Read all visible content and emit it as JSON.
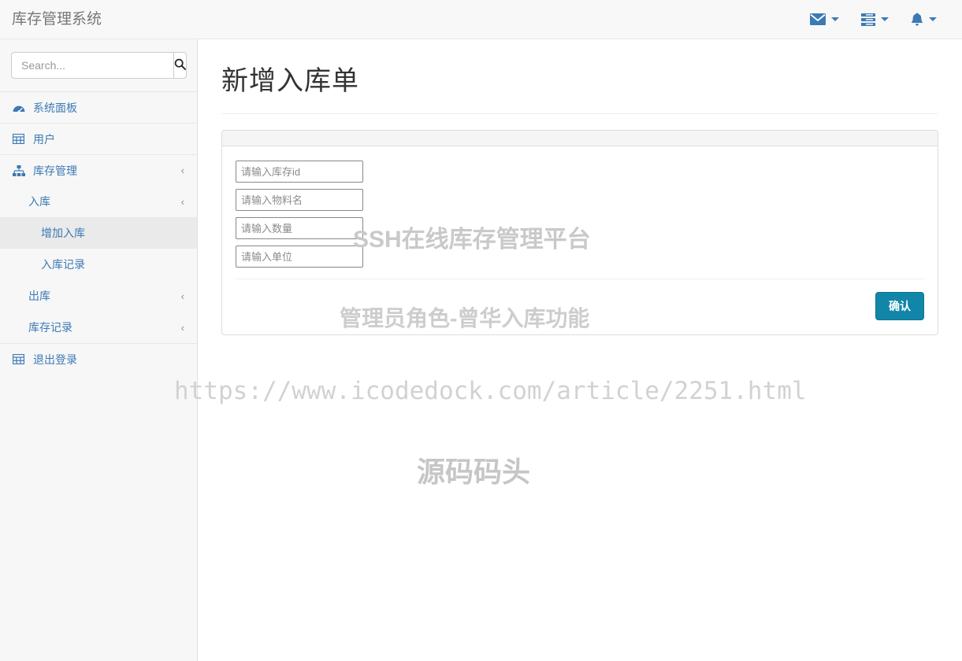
{
  "navbar": {
    "brand": "库存管理系统",
    "items": [
      {
        "icon": "envelope-icon",
        "name": "messages-dropdown"
      },
      {
        "icon": "tasks-icon",
        "name": "tasks-dropdown"
      },
      {
        "icon": "bell-icon",
        "name": "alerts-dropdown"
      }
    ]
  },
  "sidebar": {
    "search": {
      "value": "",
      "placeholder": "Search...",
      "button_icon": "search-icon"
    },
    "items": [
      {
        "label": "系统面板",
        "icon": "dashboard-icon",
        "chevron": "",
        "level": 0
      },
      {
        "label": "用户",
        "icon": "table-icon",
        "chevron": "",
        "level": 0
      },
      {
        "label": "库存管理",
        "icon": "sitemap-icon",
        "chevron": "‹",
        "level": 0
      },
      {
        "label": "入库",
        "icon": "",
        "chevron": "‹",
        "level": 1
      },
      {
        "label": "增加入库",
        "icon": "",
        "chevron": "",
        "level": 2,
        "active": true
      },
      {
        "label": "入库记录",
        "icon": "",
        "chevron": "",
        "level": 2
      },
      {
        "label": "出库",
        "icon": "",
        "chevron": "‹",
        "level": 1
      },
      {
        "label": "库存记录",
        "icon": "",
        "chevron": "‹",
        "level": 1
      },
      {
        "label": "退出登录",
        "icon": "table-icon",
        "chevron": "",
        "level": 0
      }
    ]
  },
  "main": {
    "page_title": "新增入库单",
    "form": {
      "fields": [
        {
          "name": "stock-id-field",
          "value": "",
          "placeholder": "请输入库存id"
        },
        {
          "name": "material-name-field",
          "value": "",
          "placeholder": "请输入物料名"
        },
        {
          "name": "quantity-field",
          "value": "",
          "placeholder": "请输入数量"
        },
        {
          "name": "unit-field",
          "value": "",
          "placeholder": "请输入单位"
        }
      ],
      "submit_label": "确认"
    }
  },
  "watermarks": {
    "platform": "SSH在线库存管理平台",
    "role": "管理员角色-曾华入库功能",
    "url": "https://www.icodedock.com/article/2251.html",
    "site": "源码码头"
  },
  "colors": {
    "accent": "#3c7ab5",
    "submit": "#1186a8",
    "sidebar_bg": "#f7f7f7",
    "navbar_bg": "#f8f8f8",
    "watermark": "#c9c9c9"
  }
}
